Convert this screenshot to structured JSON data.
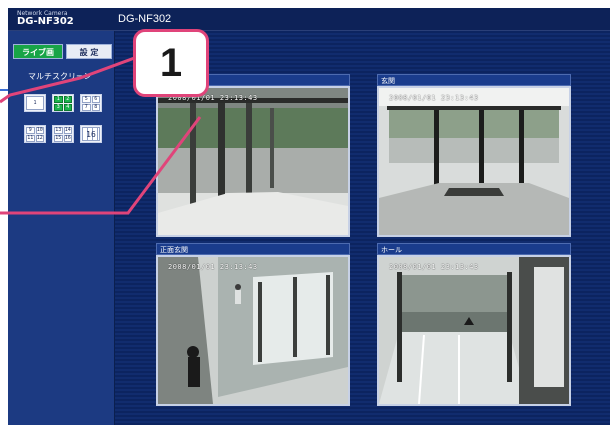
{
  "header": {
    "brand_small": "Network Camera",
    "brand_model": "DG-NF302",
    "page_title": "DG-NF302"
  },
  "left_panel": {
    "live_button": "ライブ画",
    "setup_button": "設 定",
    "multi_screen_label": "マルチスクリーン",
    "grid_buttons": [
      {
        "name": "1-screen",
        "cells": [
          "1"
        ],
        "active": false
      },
      {
        "name": "4-screen-1-4",
        "cells": [
          "1",
          "2",
          "3",
          "4"
        ],
        "active": true
      },
      {
        "name": "4-screen-5-8",
        "cells": [
          "5",
          "6",
          "7",
          "8"
        ],
        "active": false
      },
      {
        "name": "4-screen-9-12",
        "cells": [
          "9",
          "10",
          "11",
          "12"
        ],
        "active": false
      },
      {
        "name": "4-screen-13-16",
        "cells": [
          "13",
          "14",
          "15",
          "16"
        ],
        "active": false
      },
      {
        "name": "16-screen",
        "cells": [
          "16"
        ],
        "active": false
      }
    ]
  },
  "cameras": [
    {
      "title": "",
      "timestamp": "2008/01/01 23:13:43"
    },
    {
      "title": "玄関",
      "timestamp": "2008/01/01 23:13:43"
    },
    {
      "title": "正面玄関",
      "timestamp": "2008/01/01 23:13:43"
    },
    {
      "title": "ホール",
      "timestamp": "2008/01/01 23:13:43"
    }
  ],
  "callout": {
    "number": "1"
  },
  "colors": {
    "window_bg": "#0b1f4e",
    "panel_bg": "#1c3a82",
    "active_green": "#18a447",
    "callout_pink": "#e0447a"
  }
}
